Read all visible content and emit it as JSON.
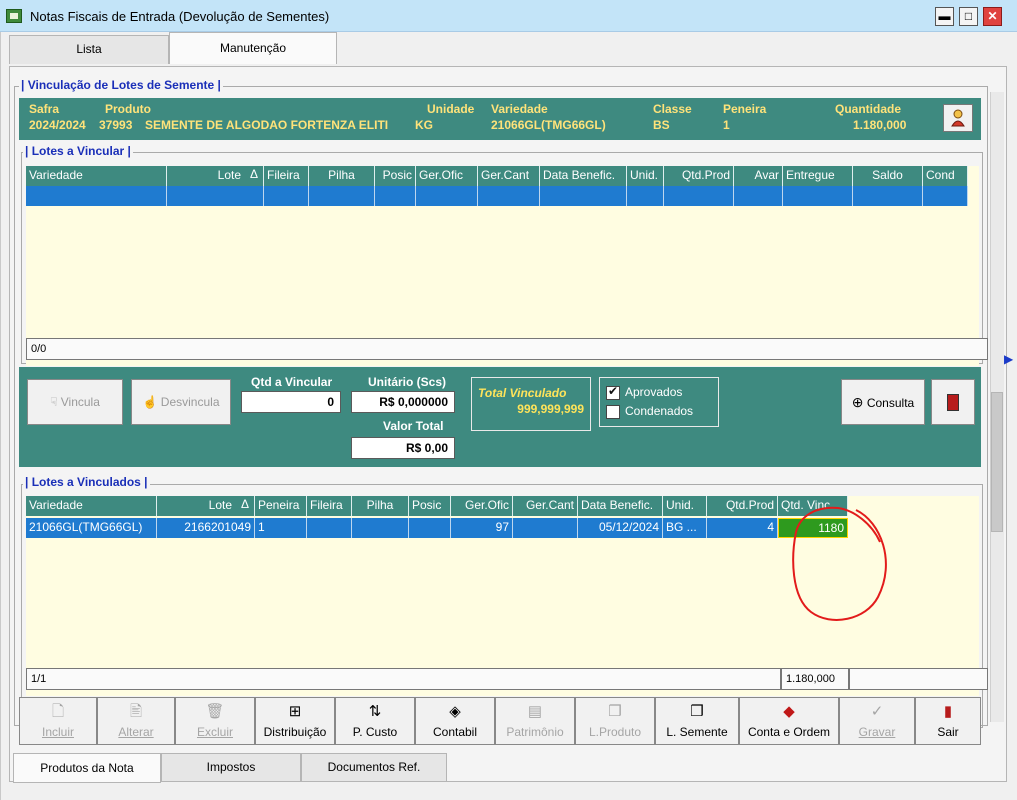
{
  "window": {
    "title": "Notas Fiscais de Entrada (Devolução de Sementes)"
  },
  "tabs_top": [
    {
      "label": "Lista"
    },
    {
      "label": "Manutenção"
    }
  ],
  "vinculacao": {
    "group_title": "| Vinculação de Lotes de Semente |",
    "header": {
      "safra_label": "Safra",
      "safra_value": "2024/2024",
      "produto_label": "Produto",
      "produto_code": "37993",
      "produto_desc": "SEMENTE DE ALGODAO FORTENZA ELITI",
      "unidade_label": "Unidade",
      "unidade_value": "KG",
      "variedade_label": "Variedade",
      "variedade_value": "21066GL(TMG66GL)",
      "classe_label": "Classe",
      "classe_value": "BS",
      "peneira_label": "Peneira",
      "peneira_value": "1",
      "quantidade_label": "Quantidade",
      "quantidade_value": "1.180,000"
    }
  },
  "lotes_a_vincular": {
    "title": "| Lotes a Vincular |",
    "columns": [
      "Variedade",
      "Lote",
      "Fileira",
      "Pilha",
      "Posic",
      "Ger.Ofic",
      "Ger.Cant",
      "Data Benefic.",
      "Unid.",
      "Qtd.Prod",
      "Avar",
      "Entregue",
      "Saldo",
      "Cond"
    ],
    "sort_indicator": "Δ",
    "footer": "0/0"
  },
  "vinculo_controls": {
    "vincula_label": "Vincula",
    "desvincula_label": "Desvincula",
    "qtd_a_vincular_label": "Qtd a Vincular",
    "qtd_a_vincular_value": "0",
    "unitario_label": "Unitário (Scs)",
    "unitario_value": "R$ 0,000000",
    "valor_total_label": "Valor Total",
    "valor_total_value": "R$ 0,00",
    "total_vinculado_label": "Total Vinculado",
    "total_vinculado_value": "999,999,999",
    "aprovados_label": "Aprovados",
    "aprovados_checked": true,
    "condenados_label": "Condenados",
    "condenados_checked": false,
    "consulta_label": "Consulta"
  },
  "lotes_vinculados": {
    "title": "| Lotes a Vinculados |",
    "columns": [
      "Variedade",
      "Lote",
      "Peneira",
      "Fileira",
      "Pilha",
      "Posic",
      "Ger.Ofic",
      "Ger.Cant",
      "Data Benefic.",
      "Unid.",
      "Qtd.Prod",
      "Qtd. Vinc"
    ],
    "sort_indicator": "Δ",
    "rows": [
      {
        "variedade": "21066GL(TMG66GL)",
        "lote": "2166201049",
        "peneira": "1",
        "fileira": "",
        "pilha": "",
        "posic": "",
        "ger_ofic": "97",
        "ger_cant": "",
        "data_benefic": "05/12/2024",
        "unid": "BG ...",
        "qtd_prod": "4",
        "qtd_vinc": "1180"
      }
    ],
    "footer_count": "1/1",
    "footer_total": "1.180,000"
  },
  "toolbar": [
    {
      "label": "Incluir",
      "icon": "new-doc-icon",
      "glyph": "🗋",
      "enabled": false
    },
    {
      "label": "Alterar",
      "icon": "edit-doc-icon",
      "glyph": "🖹",
      "enabled": false
    },
    {
      "label": "Excluir",
      "icon": "trash-icon",
      "glyph": "🗑",
      "enabled": false
    },
    {
      "label": "Distribuição",
      "icon": "tree-icon",
      "glyph": "⊞",
      "enabled": true
    },
    {
      "label": "P. Custo",
      "icon": "cost-icon",
      "glyph": "⇅",
      "enabled": true
    },
    {
      "label": "Contabil",
      "icon": "ledger-icon",
      "glyph": "◈",
      "enabled": true
    },
    {
      "label": "Patrimônio",
      "icon": "asset-icon",
      "glyph": "▤",
      "enabled": false
    },
    {
      "label": "L.Produto",
      "icon": "product-icon",
      "glyph": "❒",
      "enabled": false
    },
    {
      "label": "L. Semente",
      "icon": "seed-icon",
      "glyph": "❒",
      "enabled": true
    },
    {
      "label": "Conta e Ordem",
      "icon": "account-icon",
      "glyph": "◆",
      "enabled": true
    },
    {
      "label": "Gravar",
      "icon": "check-icon",
      "glyph": "✓",
      "enabled": false
    },
    {
      "label": "Sair",
      "icon": "exit-door-icon",
      "glyph": "▮",
      "enabled": true
    }
  ],
  "tabs_bottom": [
    {
      "label": "Produtos da Nota"
    },
    {
      "label": "Impostos"
    },
    {
      "label": "Documentos Ref."
    }
  ],
  "colors": {
    "band": "#3e8a80",
    "selected_row": "#1f7bd0",
    "grid_bg": "#fffde1",
    "highlight_cell": "#2e9a1e"
  }
}
